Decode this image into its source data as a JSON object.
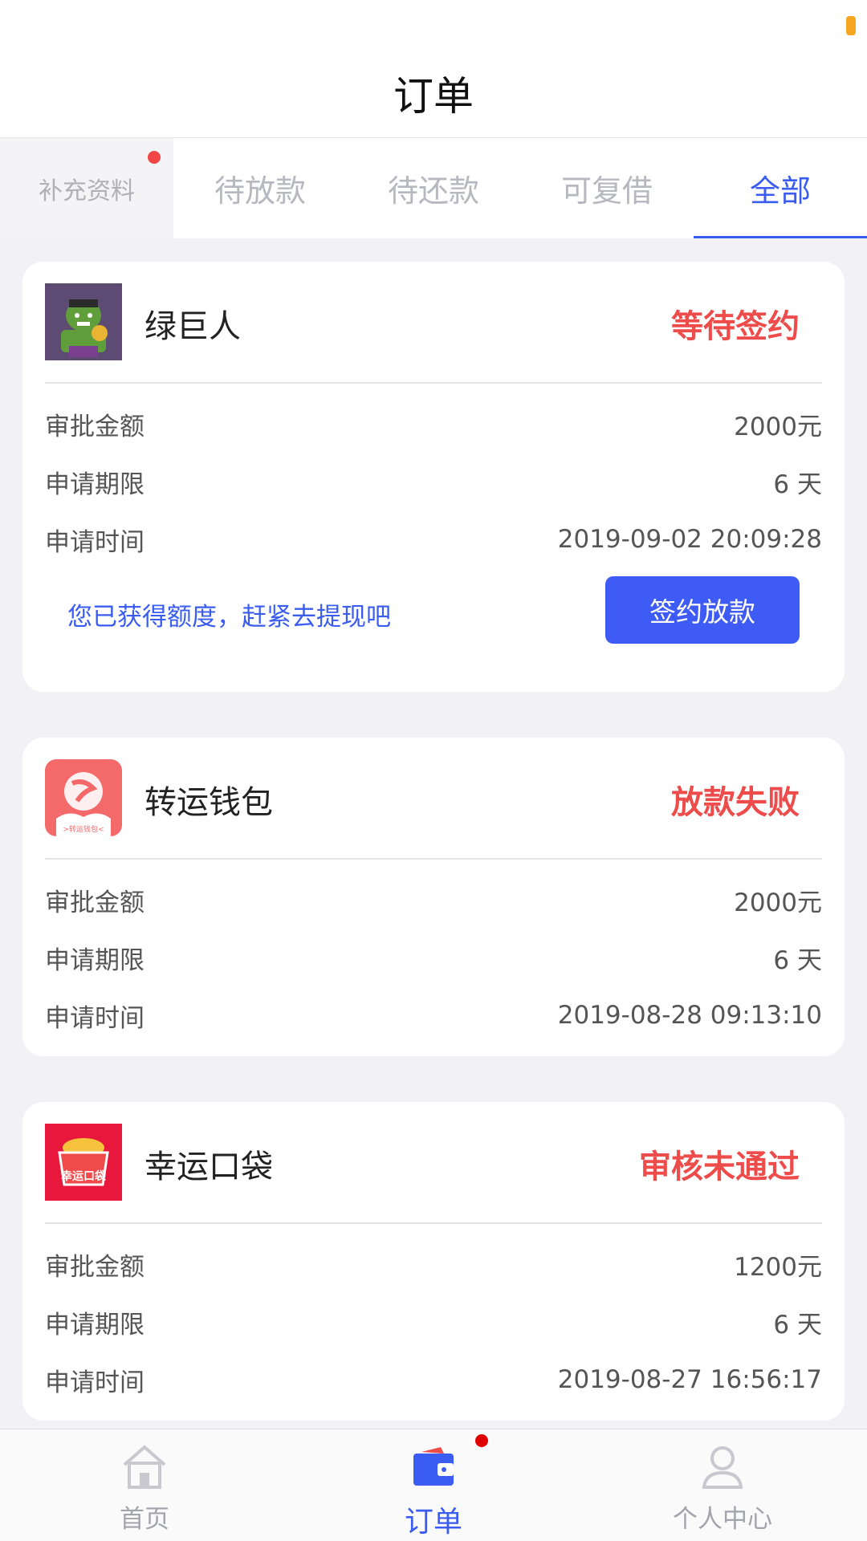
{
  "header": {
    "title": "订单"
  },
  "tabs": [
    {
      "label": "补充资料"
    },
    {
      "label": "待放款"
    },
    {
      "label": "待还款"
    },
    {
      "label": "可复借"
    },
    {
      "label": "全部"
    }
  ],
  "orders": [
    {
      "name": "绿巨人",
      "status": "等待签约",
      "rows": [
        {
          "label": "审批金额",
          "value": "2000元"
        },
        {
          "label": "申请期限",
          "value": "6 天"
        },
        {
          "label": "申请时间",
          "value": "2019-09-02 20:09:28"
        }
      ],
      "promo": "您已获得额度，赶紧去提现吧",
      "button": "签约放款"
    },
    {
      "name": "转运钱包",
      "status": "放款失败",
      "logo_text": ">转运钱包<",
      "rows": [
        {
          "label": "审批金额",
          "value": "2000元"
        },
        {
          "label": "申请期限",
          "value": "6 天"
        },
        {
          "label": "申请时间",
          "value": "2019-08-28 09:13:10"
        }
      ]
    },
    {
      "name": "幸运口袋",
      "status": "审核未通过",
      "logo_text": "幸运口袋",
      "rows": [
        {
          "label": "审批金额",
          "value": "1200元"
        },
        {
          "label": "申请期限",
          "value": "6 天"
        },
        {
          "label": "申请时间",
          "value": "2019-08-27 16:56:17"
        }
      ]
    }
  ],
  "bottom_nav": [
    {
      "label": "首页",
      "icon": "home-icon"
    },
    {
      "label": "订单",
      "icon": "wallet-icon"
    },
    {
      "label": "个人中心",
      "icon": "user-icon"
    }
  ],
  "colors": {
    "accent": "#3a5cf0",
    "status_red": "#ee4b4b",
    "button": "#3f5bf6"
  }
}
